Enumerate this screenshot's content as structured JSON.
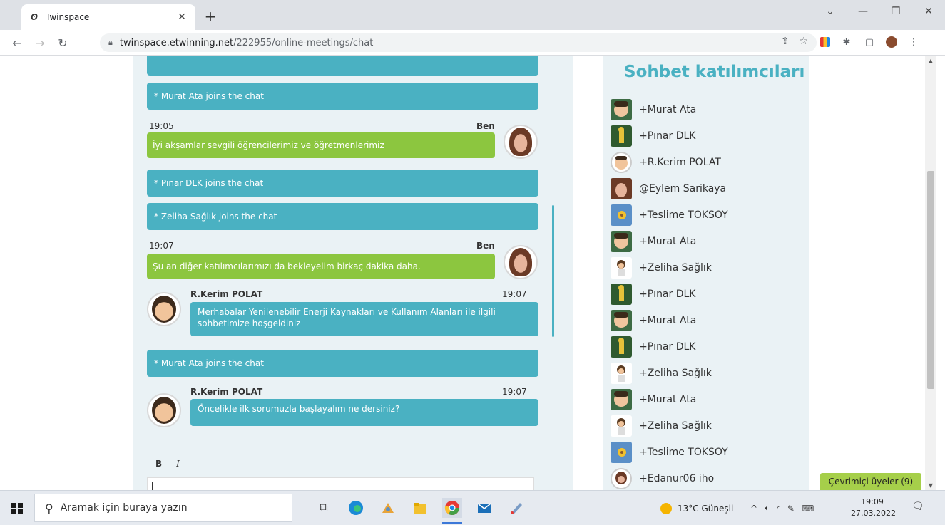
{
  "browser": {
    "tab_title": "Twinspace",
    "url_host": "twinspace.etwinning.net",
    "url_path": "/222955/online-meetings/chat"
  },
  "chat": {
    "top_partial": "",
    "messages": [
      {
        "kind": "system",
        "text": "* Murat Ata joins the chat"
      },
      {
        "kind": "own",
        "time": "19:05",
        "sender": "Ben",
        "text": "İyi akşamlar sevgili öğrencilerimiz ve öğretmenlerimiz"
      },
      {
        "kind": "system",
        "text": "* Pınar DLK joins the chat"
      },
      {
        "kind": "system",
        "text": "* Zeliha Sağlık joins the chat"
      },
      {
        "kind": "own",
        "time": "19:07",
        "sender": "Ben",
        "text": "Şu an diğer katılımcılarımızı da bekleyelim birkaç dakika daha."
      },
      {
        "kind": "other",
        "sender": "R.Kerim POLAT",
        "time": "19:07",
        "text": "Merhabalar Yenilenebilir Enerji Kaynakları ve Kullanım Alanları ile ilgili sohbetimize hoşgeldiniz"
      },
      {
        "kind": "system",
        "text": "* Murat Ata joins the chat"
      },
      {
        "kind": "other",
        "sender": "R.Kerim POLAT",
        "time": "19:07",
        "text": "Öncelikle ilk sorumuzla başlayalım ne dersiniz?"
      }
    ],
    "editor": {
      "bold_label": "B",
      "italic_label": "I"
    }
  },
  "participants": {
    "title": "Sohbet katılımcıları",
    "items": [
      {
        "name": "+Murat Ata",
        "avatar": "boy-avatar"
      },
      {
        "name": "+Pınar DLK",
        "avatar": "figure-avatar"
      },
      {
        "name": "+R.Kerim POLAT",
        "avatar": "man-avatar"
      },
      {
        "name": "@Eylem Sarikaya",
        "avatar": "woman-photo-avatar"
      },
      {
        "name": "+Teslime TOKSOY",
        "avatar": "flower-avatar"
      },
      {
        "name": "+Murat Ata",
        "avatar": "boy-avatar"
      },
      {
        "name": "+Zeliha Sağlık",
        "avatar": "girl-avatar"
      },
      {
        "name": "+Pınar DLK",
        "avatar": "figure-avatar"
      },
      {
        "name": "+Murat Ata",
        "avatar": "boy-avatar"
      },
      {
        "name": "+Pınar DLK",
        "avatar": "figure-avatar"
      },
      {
        "name": "+Zeliha Sağlık",
        "avatar": "girl-avatar"
      },
      {
        "name": "+Murat Ata",
        "avatar": "boy-avatar"
      },
      {
        "name": "+Zeliha Sağlık",
        "avatar": "girl-avatar"
      },
      {
        "name": "+Teslime TOKSOY",
        "avatar": "flower-avatar"
      },
      {
        "name": "+Edanur06 iho",
        "avatar": "girl2-avatar"
      }
    ],
    "online_label": "Çevrimiçi üyeler (9)"
  },
  "taskbar": {
    "search_placeholder": "Aramak için buraya yazın",
    "weather": "13°C Güneşli",
    "time": "19:09",
    "date": "27.03.2022"
  },
  "colors": {
    "teal": "#4ab1c2",
    "green": "#8cc63f",
    "panel_bg": "#eaf2f5",
    "online_badge": "#a6cf4a"
  }
}
